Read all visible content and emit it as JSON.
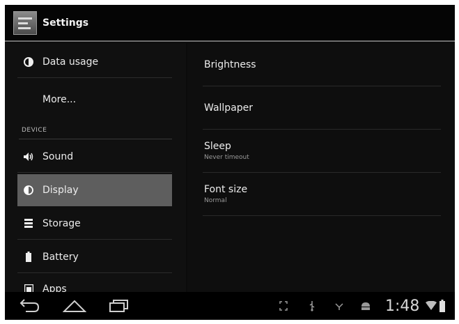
{
  "action_bar": {
    "title": "Settings",
    "app_icon": "settings-icon"
  },
  "left_list": {
    "items_top": [
      {
        "label": "Data usage",
        "icon": "data-usage-icon"
      },
      {
        "label": "More...",
        "icon": ""
      }
    ],
    "section_header": "DEVICE",
    "items_device": [
      {
        "label": "Sound",
        "icon": "sound-icon"
      },
      {
        "label": "Display",
        "icon": "display-icon",
        "selected": true
      },
      {
        "label": "Storage",
        "icon": "storage-icon"
      },
      {
        "label": "Battery",
        "icon": "battery-icon"
      },
      {
        "label": "Apps",
        "icon": "apps-icon"
      }
    ]
  },
  "detail": {
    "items": [
      {
        "title": "Brightness",
        "summary": ""
      },
      {
        "title": "Wallpaper",
        "summary": ""
      },
      {
        "title": "Sleep",
        "summary": "Never timeout"
      },
      {
        "title": "Font size",
        "summary": "Normal"
      }
    ]
  },
  "nav_bar": {
    "buttons": [
      "back-icon",
      "home-icon",
      "recent-apps-icon"
    ],
    "status_icons": [
      "screenshot-icon",
      "usb-icon",
      "debug-icon",
      "android-icon",
      "wifi-icon",
      "battery-status-icon"
    ],
    "clock": "1:48"
  },
  "colors": {
    "background": "#0b0b0b",
    "selected_item": "#5e5e5e",
    "action_bar_divider": "#6f6f6f"
  }
}
